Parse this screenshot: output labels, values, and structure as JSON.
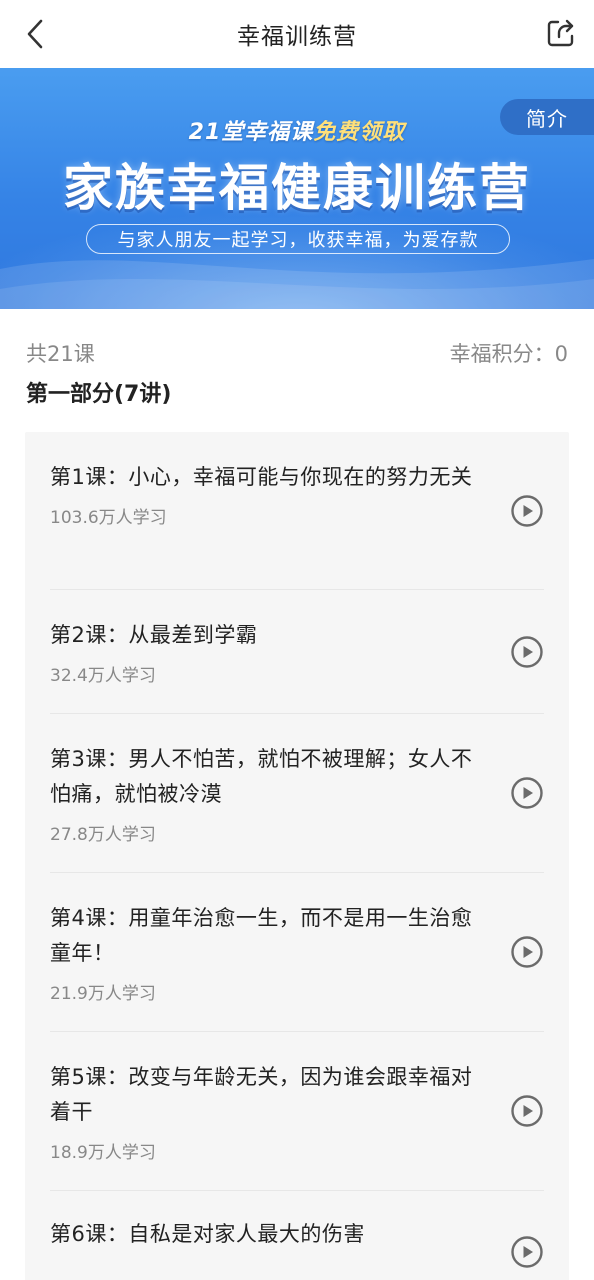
{
  "header": {
    "title": "幸福训练营"
  },
  "banner": {
    "subtitle_prefix": "21堂幸福课",
    "subtitle_highlight": "免费领取",
    "headline": "家族幸福健康训练营",
    "tagline": "与家人朋友一起学习，收获幸福，为爱存款",
    "intro_label": "简介"
  },
  "summary": {
    "lesson_total": "共21课",
    "points": "幸福积分：0"
  },
  "section": {
    "title": "第一部分(7讲)"
  },
  "lessons": [
    {
      "title": "第1课：小心，幸福可能与你现在的努力无关",
      "learners": "103.6万人学习"
    },
    {
      "title": "第2课：从最差到学霸",
      "learners": "32.4万人学习"
    },
    {
      "title": "第3课：男人不怕苦，就怕不被理解；女人不怕痛，就怕被冷漠",
      "learners": "27.8万人学习"
    },
    {
      "title": "第4课：用童年治愈一生，而不是用一生治愈童年！",
      "learners": "21.9万人学习"
    },
    {
      "title": "第5课：改变与年龄无关，因为谁会跟幸福对着干",
      "learners": "18.9万人学习"
    },
    {
      "title": "第6课：自私是对家人最大的伤害",
      "learners": ""
    }
  ],
  "colors": {
    "banner_blue": "#3583e6",
    "meta_gray": "#888888",
    "list_bg": "#f6f6f6"
  }
}
